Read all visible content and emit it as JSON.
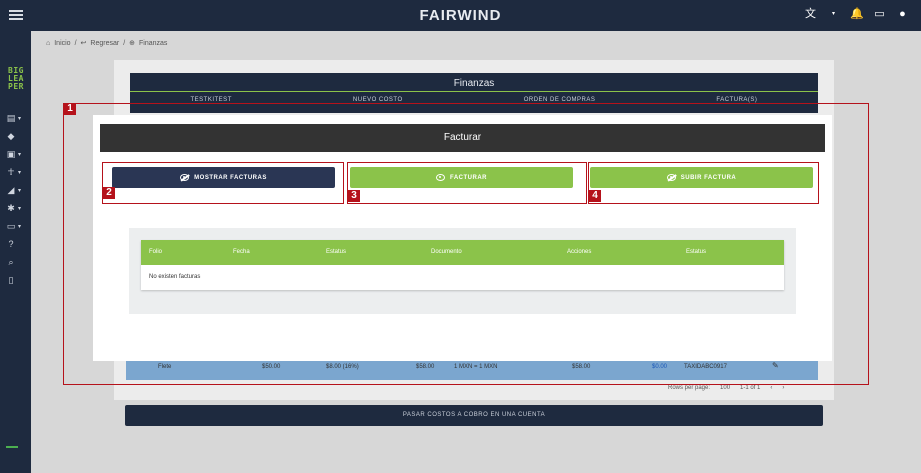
{
  "topbar": {
    "brand": "FAIRWIND",
    "icons": [
      "menu-icon",
      "translate-icon",
      "notifications-icon",
      "messages-icon",
      "account-icon"
    ]
  },
  "sidebar": {
    "logo_lines": [
      "BIG",
      "LEA",
      "PER"
    ],
    "items": [
      {
        "icon": "document-icon"
      },
      {
        "icon": "tag-icon"
      },
      {
        "icon": "chart-icon"
      },
      {
        "icon": "person-run-icon"
      },
      {
        "icon": "truck-icon"
      },
      {
        "icon": "settings-icon"
      },
      {
        "icon": "card-icon"
      },
      {
        "icon": "help-icon"
      },
      {
        "icon": "search-icon"
      },
      {
        "icon": "book-icon"
      }
    ]
  },
  "breadcrumb": {
    "home": "Inicio",
    "back": "Regresar",
    "current": "Finanzas"
  },
  "finanzas": {
    "title": "Finanzas",
    "tabs": [
      "TESTKITEST",
      "NUEVO COSTO",
      "ORDEN DE COMPRAS",
      "FACTURA(S)"
    ]
  },
  "background_row": {
    "concept": "Flete",
    "amount": "$50.00",
    "tax": "$8.00 (16%)",
    "subtotal": "$58.00",
    "rate": "1 MXN = 1 MXN",
    "total": "$58.00",
    "link": "$0.00",
    "code": "TAXIDABC0917"
  },
  "pagination": {
    "rows_label": "Rows per page:",
    "rows_value": "100",
    "range": "1-1 of 1"
  },
  "bottom_button": "PASAR COSTOS A COBRO EN UNA CUENTA",
  "modal": {
    "title": "Facturar",
    "buttons": {
      "mostrar": "MOSTRAR FACTURAS",
      "facturar": "FACTURAR",
      "subir": "SUBIR FACTURA"
    },
    "table": {
      "columns": [
        "Folio",
        "Fecha",
        "Estatus",
        "Documento",
        "Acciones",
        "Estatus"
      ],
      "empty": "No existen facturas"
    }
  },
  "annotations": [
    "1",
    "2",
    "3",
    "4"
  ],
  "colors": {
    "navy": "#1e2a3f",
    "green": "#8bc34a",
    "annotation_red": "#b5121b"
  }
}
